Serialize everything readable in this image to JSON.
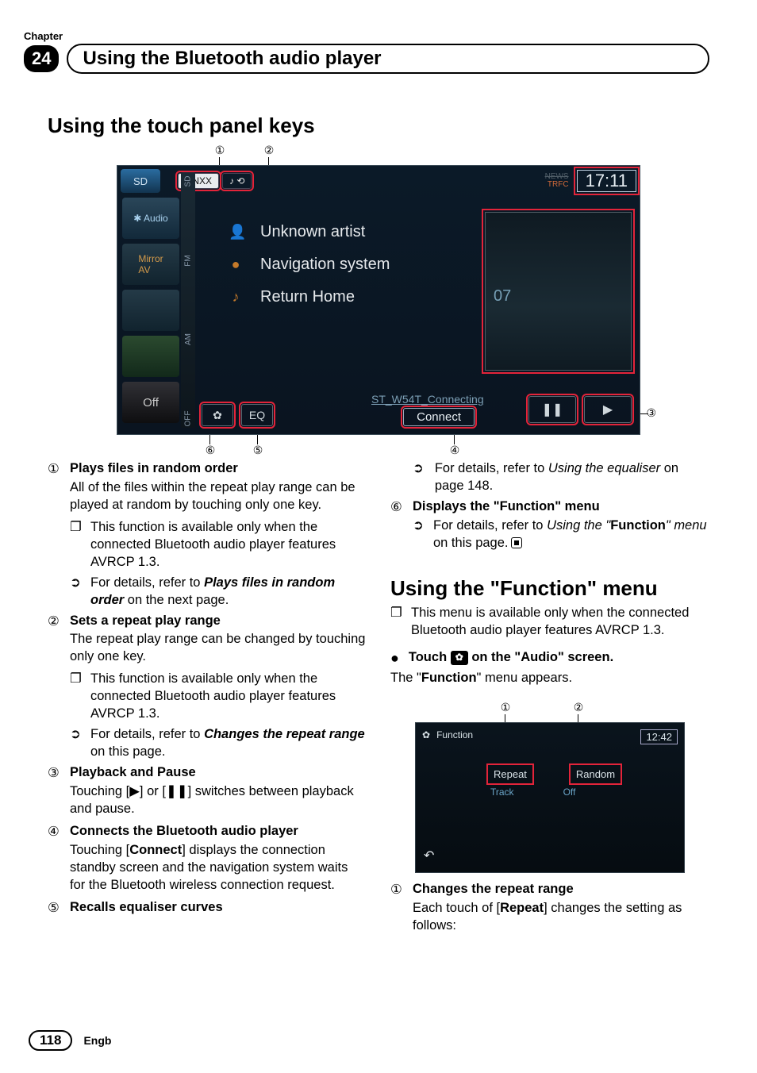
{
  "chapter": {
    "label": "Chapter",
    "number": "24",
    "title": "Using the Bluetooth audio player"
  },
  "section1": {
    "title": "Using the touch panel keys"
  },
  "shot1": {
    "callouts_top": [
      "①",
      "②"
    ],
    "callouts_bottom_left": [
      "⑥",
      "⑤"
    ],
    "callouts_bottom_right": "④",
    "callout_side": "③",
    "sd": "SD",
    "onxx": "ONXX",
    "news": "NEWS",
    "trfc": "TRFC",
    "time": "17:11",
    "audio": "Audio",
    "mirror": "Mirror",
    "av": "AV",
    "off": "Off",
    "vtabs": [
      "SD",
      "FM",
      "AM",
      "OFF"
    ],
    "artist": "Unknown artist",
    "album": "Navigation system",
    "track": "Return Home",
    "album_num": "07",
    "status": "ST_W54T_Connecting",
    "connect": "Connect",
    "eq": "EQ",
    "pause": "❚❚",
    "play": "▶"
  },
  "items": {
    "i1h": "Plays files in random order",
    "i1a": "All of the files within the repeat play range can be played at random by touching only one key.",
    "i1b": "This function is available only when the connected Bluetooth audio player features AVRCP 1.3.",
    "i1c1": "For details, refer to ",
    "i1c2": "Plays files in random order",
    "i1c3": " on the next page.",
    "i2h": "Sets a repeat play range",
    "i2a": "The repeat play range can be changed by touching only one key.",
    "i2b": "This function is available only when the connected Bluetooth audio player features AVRCP 1.3.",
    "i2c1": "For details, refer to ",
    "i2c2": "Changes the repeat range",
    "i2c3": " on this page.",
    "i3h": "Playback and Pause",
    "i3a1": "Touching [",
    "i3a2": "] or [",
    "i3a3": "] switches between playback and pause.",
    "i3play": "▶",
    "i3pause": "❚❚",
    "i4h": "Connects the Bluetooth audio player",
    "i4a1": "Touching [",
    "i4a2": "Connect",
    "i4a3": "] displays the connection standby screen and the navigation system waits for the Bluetooth wireless connection request.",
    "i5h": "Recalls equaliser curves",
    "i5a1": "For details, refer to ",
    "i5a2": "Using the equaliser",
    "i5a3": " on page 148.",
    "i6h": "Displays the \"Function\" menu",
    "i6a1": "For details, refer to ",
    "i6a2": "Using the ",
    "i6a3": "\"",
    "i6a4": "Function",
    "i6a5": "\" menu",
    "i6a6": " on this page."
  },
  "section2": {
    "title_pre": "Using the \"",
    "title_mid": "Function",
    "title_post": "\" menu",
    "note": "This menu is available only when the connected Bluetooth audio player features AVRCP 1.3.",
    "step_pre": "Touch ",
    "step_post": " on the \"Audio\" screen.",
    "result_pre": "The \"",
    "result_mid": "Function",
    "result_post": "\" menu appears."
  },
  "shot2": {
    "callouts_top": [
      "①",
      "②"
    ],
    "function": "Function",
    "time": "12:42",
    "repeat": "Repeat",
    "random": "Random",
    "track": "Track",
    "off": "Off",
    "back": "↶"
  },
  "items2": {
    "i1h": "Changes the repeat range",
    "i1a1": "Each touch of [",
    "i1a2": "Repeat",
    "i1a3": "] changes the setting as follows:"
  },
  "footer": {
    "page": "118",
    "lang": "Engb"
  },
  "nums": {
    "n1": "①",
    "n2": "②",
    "n3": "③",
    "n4": "④",
    "n5": "⑤",
    "n6": "⑥"
  }
}
